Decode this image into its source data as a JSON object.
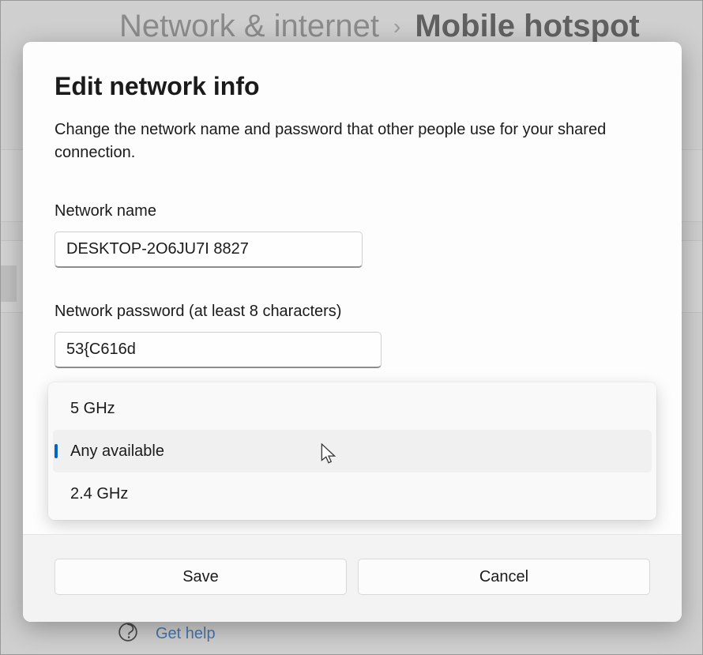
{
  "breadcrumb": {
    "parent": "Network & internet",
    "current": "Mobile hotspot"
  },
  "help_link": "Get help",
  "dialog": {
    "title": "Edit network info",
    "description": "Change the network name and password that other people use for your shared connection.",
    "network_name_label": "Network name",
    "network_name_value": "DESKTOP-2O6JU7I 8827",
    "password_label": "Network password (at least 8 characters)",
    "password_value": "53{C616d",
    "band_options": {
      "opt0": "5 GHz",
      "opt1": "Any available",
      "opt2": "2.4 GHz"
    },
    "save_label": "Save",
    "cancel_label": "Cancel"
  }
}
